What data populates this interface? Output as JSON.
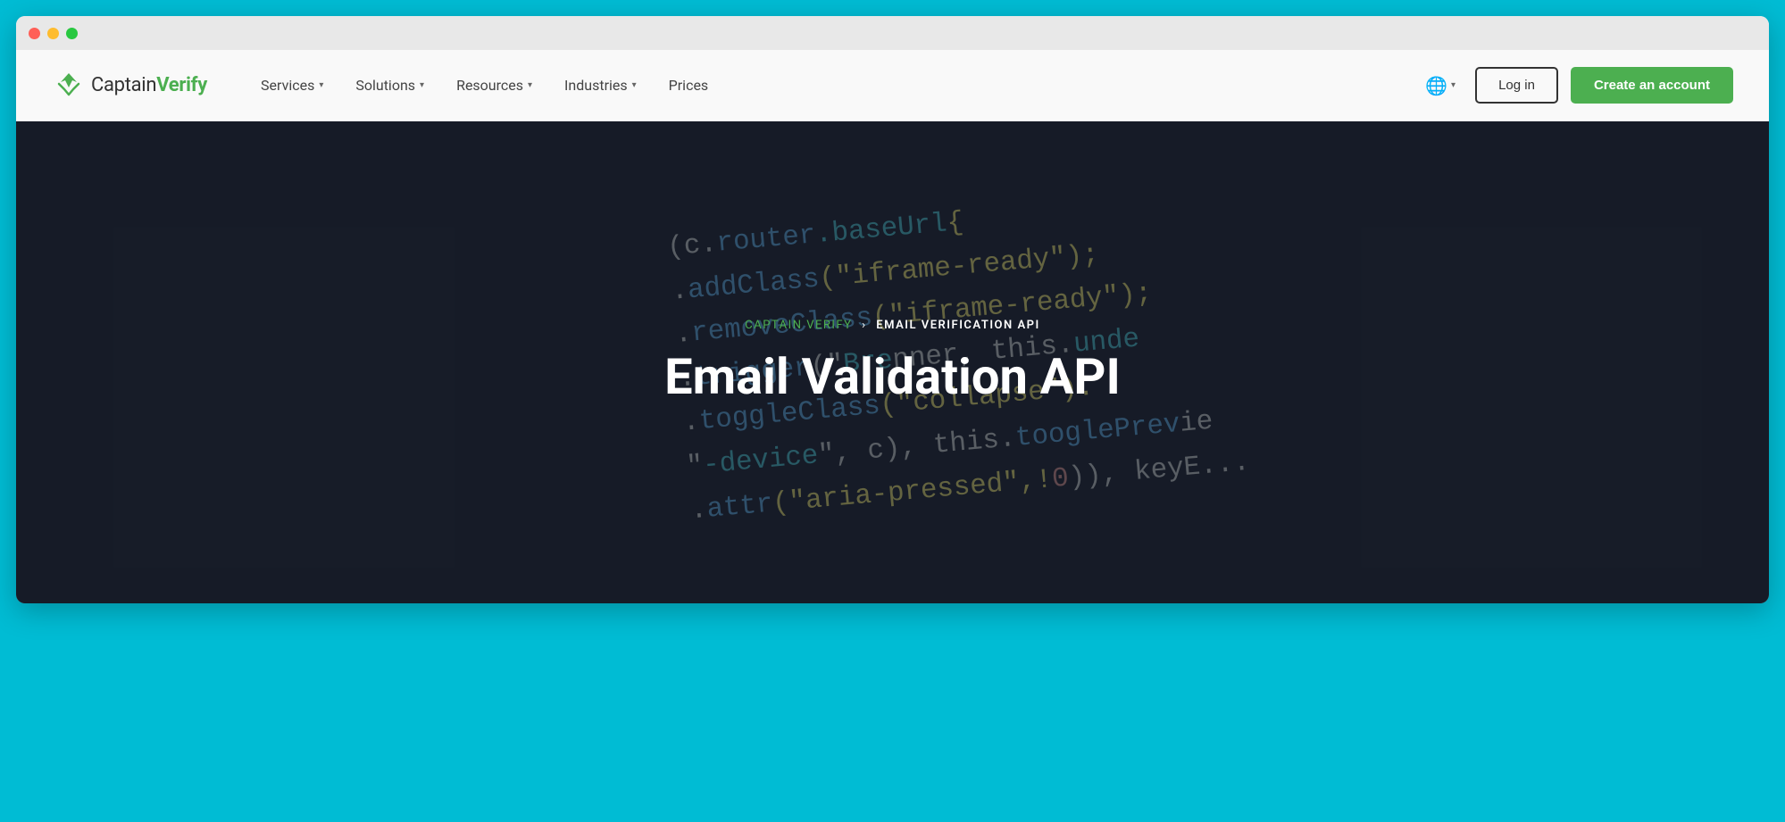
{
  "browser": {
    "traffic_lights": [
      "red",
      "yellow",
      "green"
    ]
  },
  "navbar": {
    "logo": {
      "brand_first": "Captain",
      "brand_second": "Verify"
    },
    "nav_items": [
      {
        "label": "Services",
        "has_dropdown": true
      },
      {
        "label": "Solutions",
        "has_dropdown": true
      },
      {
        "label": "Resources",
        "has_dropdown": true
      },
      {
        "label": "Industries",
        "has_dropdown": true
      },
      {
        "label": "Prices",
        "has_dropdown": false
      }
    ],
    "lang_icon": "🌐",
    "login_label": "Log in",
    "create_account_label": "Create an account"
  },
  "hero": {
    "breadcrumb_home": "CAPTAIN VERIFY",
    "breadcrumb_separator": "›",
    "breadcrumb_current": "EMAIL VERIFICATION API",
    "title": "Email Validation API",
    "code_lines": [
      {
        "parts": [
          {
            "text": "\t\t\t(c.",
            "class": "white"
          },
          {
            "text": "router",
            "class": "blue"
          },
          {
            "text": ".baseUrl",
            "class": "teal"
          },
          {
            "text": "{",
            "class": "yellow"
          }
        ]
      },
      {
        "parts": [
          {
            "text": "\t\t\t.",
            "class": "white"
          },
          {
            "text": "addClass",
            "class": "blue"
          },
          {
            "text": "(\"iframe-ready\");",
            "class": "yellow"
          }
        ]
      },
      {
        "parts": [
          {
            "text": "\t\t\t.",
            "class": "white"
          },
          {
            "text": "removeClass",
            "class": "blue"
          },
          {
            "text": "(\"iframe-ready\");",
            "class": "yellow"
          }
        ]
      },
      {
        "parts": [
          {
            "text": "\t\t\t.",
            "class": "white"
          },
          {
            "text": "trigger",
            "class": "blue"
          },
          {
            "text": "(\"",
            "class": "white"
          },
          {
            "text": "Bre",
            "class": "teal"
          },
          {
            "text": "...",
            "class": "white"
          },
          {
            "text": ", this.und",
            "class": "white"
          }
        ]
      },
      {
        "parts": [
          {
            "text": "\t\t\t.",
            "class": "white"
          },
          {
            "text": "toggleClass",
            "class": "blue"
          },
          {
            "text": "(\"collapse\").",
            "class": "yellow"
          }
        ]
      },
      {
        "parts": [
          {
            "text": "\t\t\t\"",
            "class": "white"
          },
          {
            "text": "-device",
            "class": "teal"
          },
          {
            "text": "\", c), this.",
            "class": "white"
          },
          {
            "text": "tooglePrev",
            "class": "blue"
          },
          {
            "text": "...",
            "class": "white"
          }
        ]
      },
      {
        "parts": [
          {
            "text": "\t\t\t.",
            "class": "white"
          },
          {
            "text": "attr",
            "class": "blue"
          },
          {
            "text": "(\"aria-pressed\",!",
            "class": "yellow"
          },
          {
            "text": "0",
            "class": "red"
          },
          {
            "text": ")), keyE...",
            "class": "white"
          }
        ]
      }
    ]
  },
  "colors": {
    "accent_green": "#4caf50",
    "cyan_bg": "#00bcd4",
    "nav_bg": "#f9f9f9",
    "hero_bg": "#1a1a2e"
  }
}
